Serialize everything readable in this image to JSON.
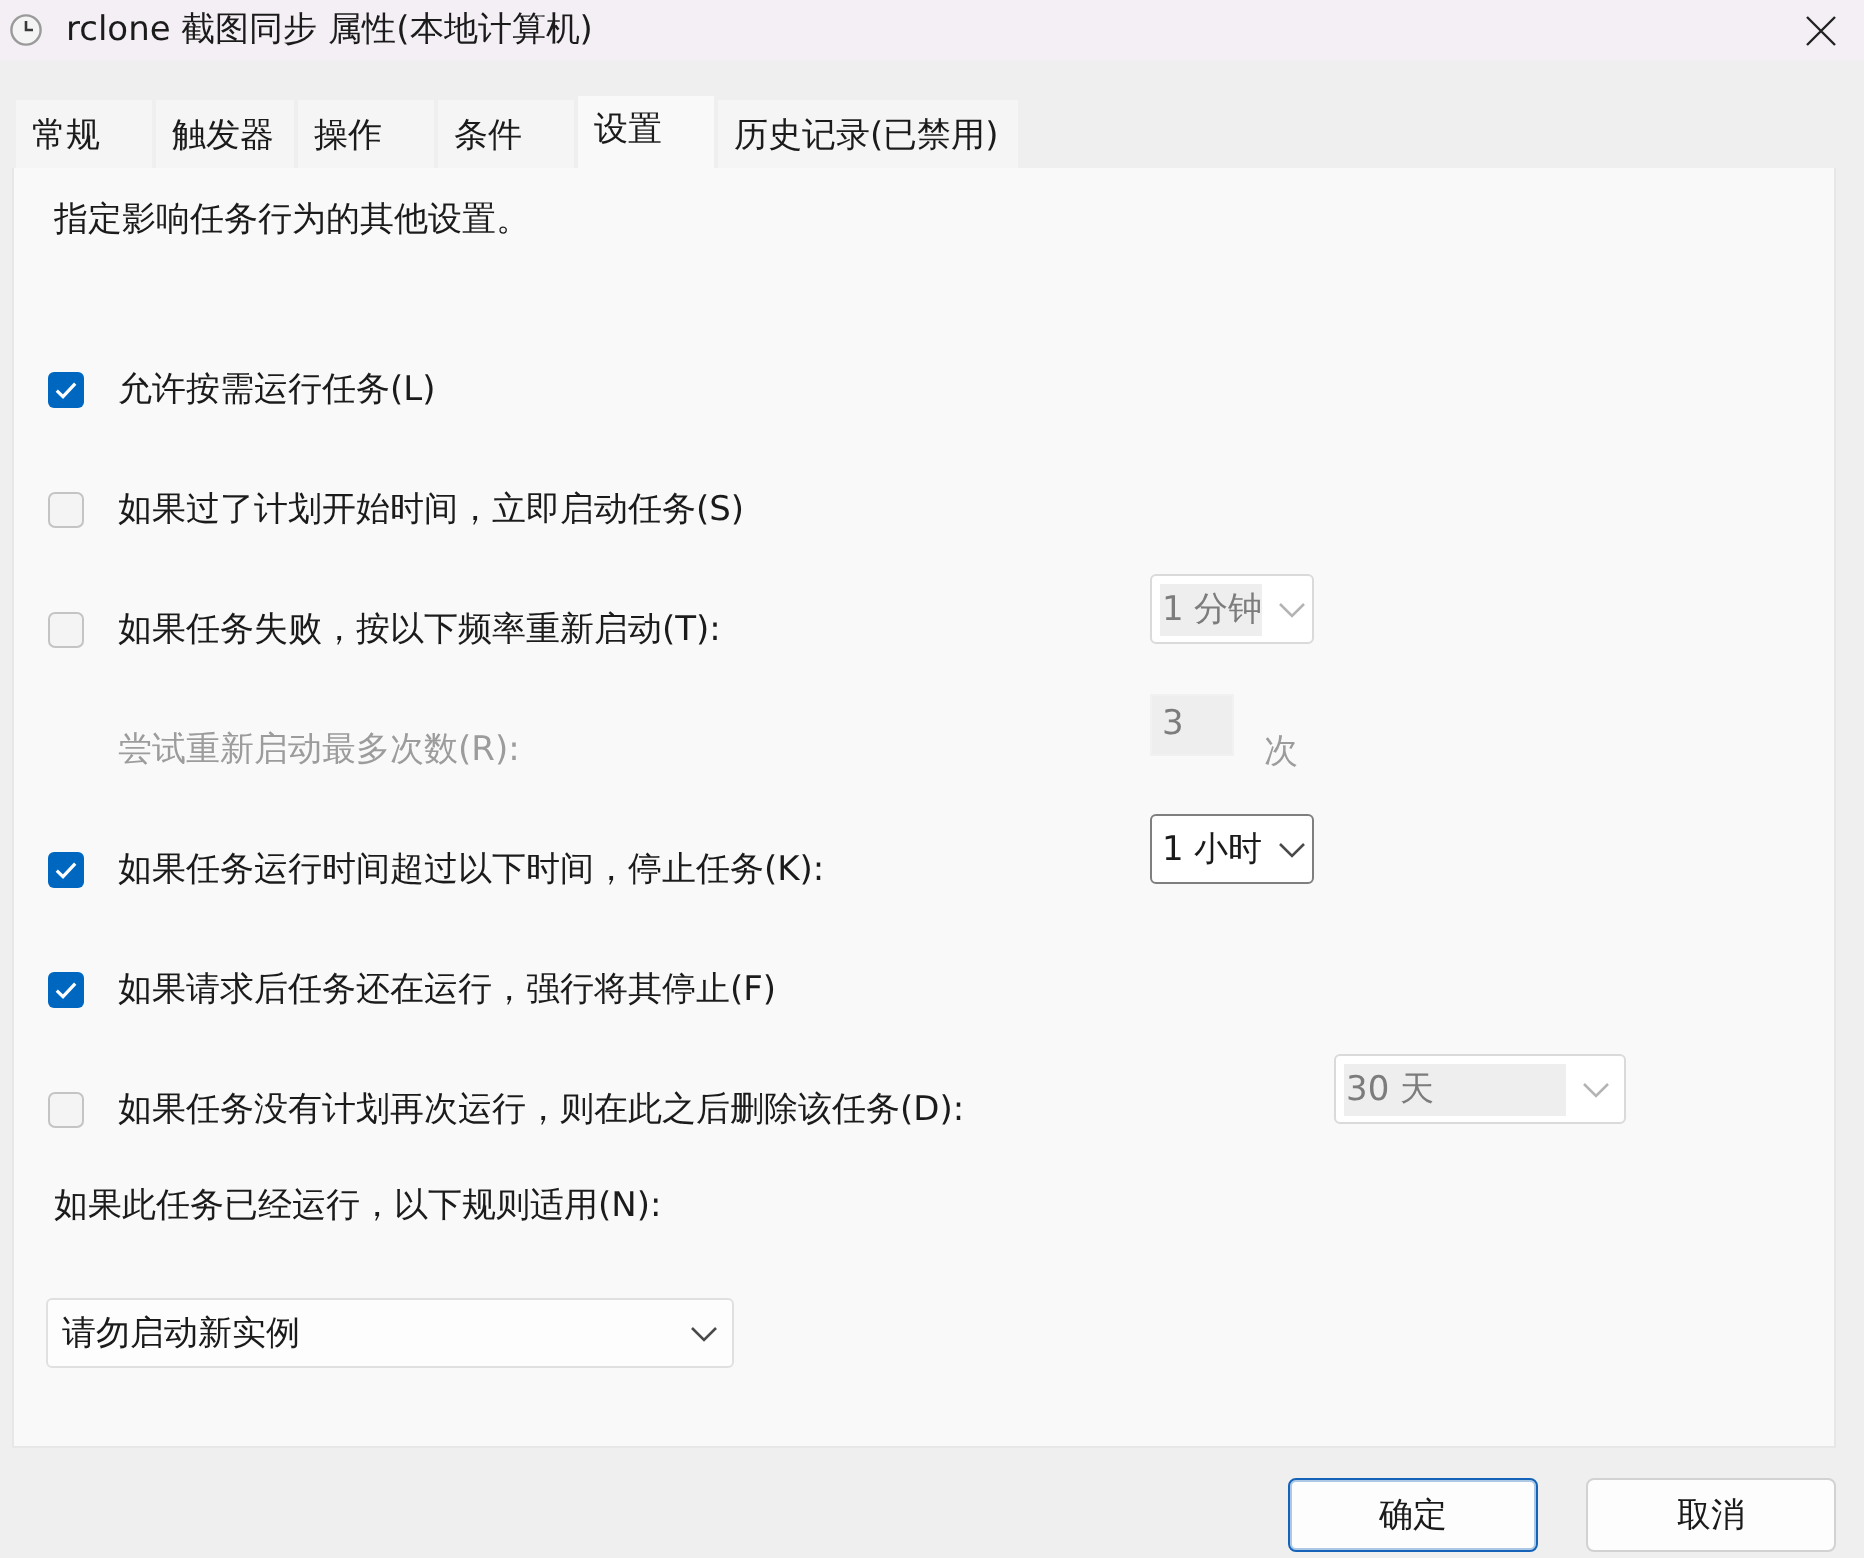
{
  "window": {
    "title": "rclone 截图同步 属性(本地计算机)"
  },
  "tabs": [
    {
      "label": "常规",
      "selected": false
    },
    {
      "label": "触发器",
      "selected": false
    },
    {
      "label": "操作",
      "selected": false
    },
    {
      "label": "条件",
      "selected": false
    },
    {
      "label": "设置",
      "selected": true
    },
    {
      "label": "历史记录(已禁用)",
      "selected": false
    }
  ],
  "description": "指定影响任务行为的其他设置。",
  "options": [
    {
      "kind": "checkbox",
      "label": "允许按需运行任务(L)",
      "checked": true
    },
    {
      "kind": "checkbox",
      "label": "如果过了计划开始时间，立即启动任务(S)",
      "checked": false
    },
    {
      "kind": "checkbox",
      "label": "如果任务失败，按以下频率重新启动(T):",
      "checked": false,
      "dropdown": {
        "value": "1 分钟",
        "disabled": true
      }
    },
    {
      "kind": "count",
      "label": "尝试重新启动最多次数(R):",
      "value": "3",
      "unit": "次",
      "disabled": true
    },
    {
      "kind": "checkbox",
      "label": "如果任务运行时间超过以下时间，停止任务(K):",
      "checked": true,
      "dropdown": {
        "value": "1 小时",
        "disabled": false
      }
    },
    {
      "kind": "checkbox",
      "label": "如果请求后任务还在运行，强行将其停止(F)",
      "checked": true
    },
    {
      "kind": "checkbox",
      "label": "如果任务没有计划再次运行，则在此之后删除该任务(D):",
      "checked": false,
      "dropdown": {
        "value": "30 天",
        "disabled": true
      }
    }
  ],
  "instance_rule": {
    "label": "如果此任务已经运行，以下规则适用(N):",
    "value": "请勿启动新实例"
  },
  "buttons": [
    {
      "label": "确定",
      "default": true
    },
    {
      "label": "取消",
      "default": false
    }
  ]
}
